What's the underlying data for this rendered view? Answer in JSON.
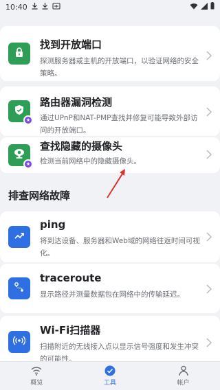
{
  "status_bar": {
    "time": "10:40",
    "left_icons": [
      "download-icon",
      "download-icon",
      "app-notification-icon"
    ],
    "right_icons": [
      "wifi-icon",
      "signal-icon",
      "battery-icon"
    ]
  },
  "tools": [
    {
      "title": "找到开放端口",
      "description": "探测服务器或主机的开放端口，以验证网络的安全策略。",
      "icon": "lock-icon",
      "icon_color": "#2e9e57",
      "premium": false
    },
    {
      "title": "路由器漏洞检测",
      "description": "通过UPnP和NAT-PMP查找并修复可能导致外部访问的开放端口。",
      "icon": "shield-icon",
      "icon_color": "#2e9e57",
      "premium": true
    },
    {
      "title": "查找隐藏的摄像头",
      "description": "检测当前网络中的隐藏摄像头。",
      "icon": "camera-icon",
      "icon_color": "#2e9e57",
      "premium": true
    }
  ],
  "section": {
    "title": "排查网络故障"
  },
  "troubleshoot": [
    {
      "title": "ping",
      "description": "将到达设备、服务器和Web域的网络往返时间可视化。",
      "icon": "trend-icon",
      "icon_color": "#2f6fe4"
    },
    {
      "title": "traceroute",
      "description": "显示路径并测量数据包在网络中的传输延迟。",
      "icon": "route-icon",
      "icon_color": "#2f6fe4"
    },
    {
      "title": "Wi-Fi扫描器",
      "description": "扫描附近的无线接入点以显示信号强度和发生冲突的可能性。",
      "icon": "wifi-scan-icon",
      "icon_color": "#2f6fe4"
    }
  ],
  "tabbar": {
    "tabs": [
      {
        "label": "概览",
        "icon": "wifi-icon",
        "active": false
      },
      {
        "label": "工具",
        "icon": "check-circle-icon",
        "active": true
      },
      {
        "label": "帐户",
        "icon": "person-icon",
        "active": false
      }
    ],
    "accent": "#2f6fe4"
  },
  "annotation": {
    "arrow_color": "#d9342b"
  }
}
